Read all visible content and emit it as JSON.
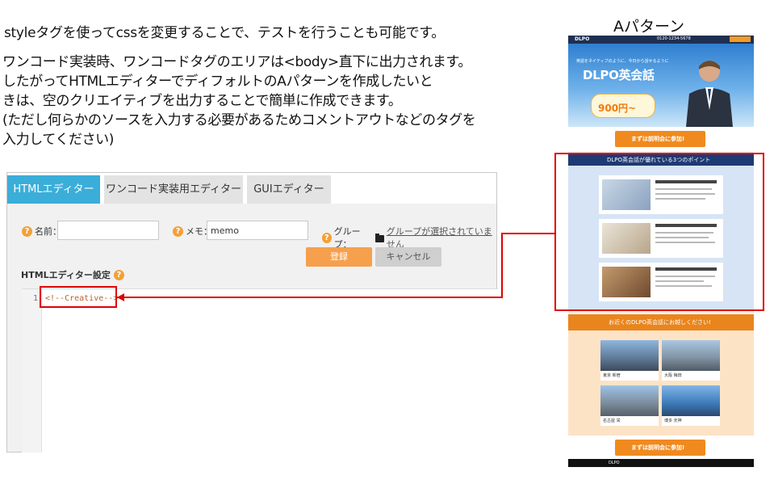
{
  "intro": "styleタグを使ってcssを変更することで、テストを行うことも可能です。",
  "paragraph": [
    "ワンコード実装時、ワンコードタグのエリアは<body>直下に出力されます。",
    "したがってHTMLエディターでディフォルトのAパターンを作成したいと",
    "きは、空のクリエイティブを出力することで簡単に作成できます。",
    "(ただし何らかのソースを入力する必要があるためコメントアウトなどのタグを",
    "入力してください)"
  ],
  "pattern_title": "Aパターン",
  "editor": {
    "tabs": [
      "HTMLエディター",
      "ワンコード実装用エディター",
      "GUIエディター"
    ],
    "name_label": "名前：",
    "name_value": "",
    "memo_label": "メモ：",
    "memo_value": "memo",
    "group_label": "グループ：",
    "group_link": "グループが選択されていません",
    "save_label": "登録",
    "cancel_label": "キャンセル",
    "settings_label": "HTMLエディター設定",
    "line_number": "1",
    "code": "<!--Creative-->",
    "help_glyph": "?"
  },
  "lp": {
    "logo": "DLPO",
    "tel": "0120-1234-5678",
    "hero_small": "英語をネイティブのように、今日から話せるように",
    "hero_title": "DLPO英会話",
    "hero_price": "900円~",
    "cta": "まずは説明会に参加!",
    "points_title": "DLPO英会話が優れている3つのポイント",
    "school_title": "お近くのDLPO英会話にお越しください!",
    "cities": [
      "東京 新宿",
      "大阪 梅田",
      "名古屋 栄",
      "博多 天神"
    ],
    "footer": "DLPO"
  },
  "colors": {
    "accent_red": "#e00000",
    "tab_active": "#3aaed8",
    "save_button": "#f6a04d",
    "code_text": "#b5642a"
  }
}
